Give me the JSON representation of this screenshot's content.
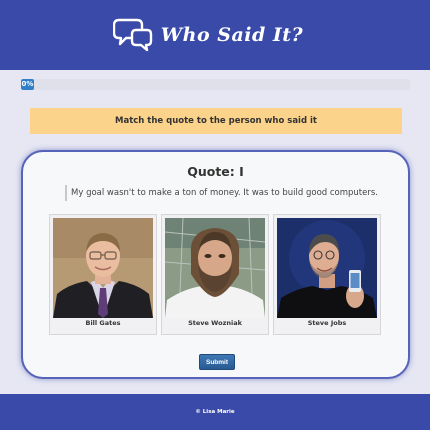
{
  "header": {
    "title": "Who Said It?",
    "logo_icon": "speech-bubbles-icon"
  },
  "progress": {
    "label": "0%",
    "value_percent": 0
  },
  "instruction": "Match the quote to the person who said it",
  "quiz": {
    "quote_title": "Quote: I",
    "quote_text": "My goal wasn't to make a ton of money. It was to build good computers.",
    "people": [
      {
        "name": "Bill Gates"
      },
      {
        "name": "Steve Wozniak"
      },
      {
        "name": "Steve Jobs"
      }
    ],
    "submit_label": "Submit"
  },
  "footer": {
    "text": "© Lisa Marie"
  },
  "colors": {
    "header_bg": "#3a4aa8",
    "page_bg": "#e6e7f3",
    "instruction_bg": "#fbd38a",
    "progress_fill": "#2f80c8",
    "card_border": "#5563bb",
    "submit_bg": "#285a92"
  }
}
